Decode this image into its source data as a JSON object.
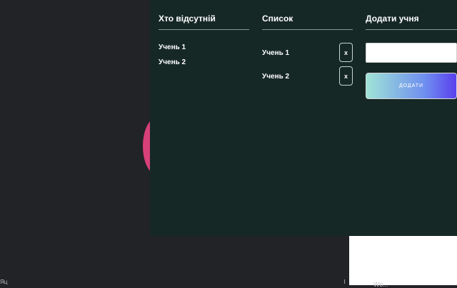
{
  "background": {
    "corner_text": "Яц",
    "white_block_text": "Wo..."
  },
  "colors": {
    "page_bg": "#222326",
    "panel_bg": "#162826",
    "accent_pink": "#d8407a",
    "button_gradient_start": "#9fe4d6",
    "button_gradient_end": "#5a3fee"
  },
  "absent": {
    "title": "Хто відсутній",
    "students": [
      "Учень 1",
      "Учень 2"
    ]
  },
  "list": {
    "title": "Список",
    "students": [
      "Учень 1",
      "Учень 2"
    ],
    "remove_label": "x"
  },
  "add": {
    "title": "Додати учня",
    "input_value": "",
    "button_label": "ДОДАТИ"
  }
}
